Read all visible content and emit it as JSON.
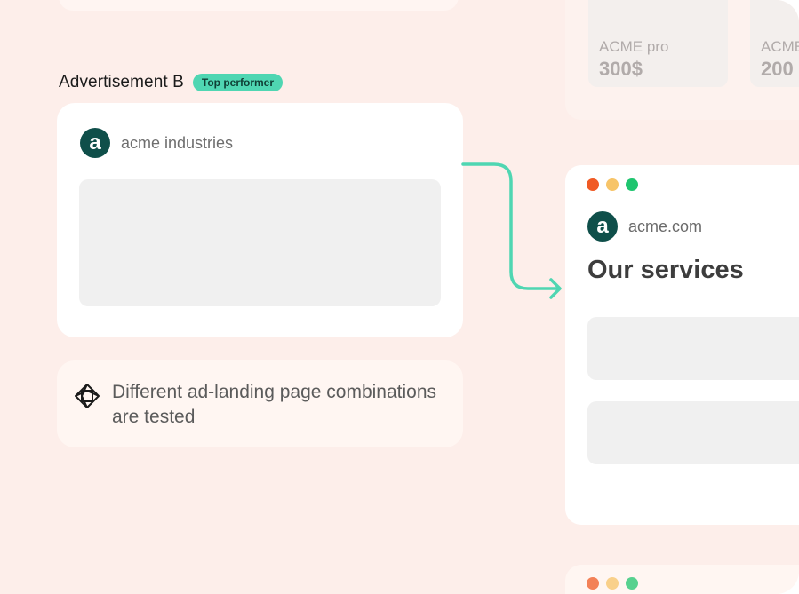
{
  "advertisement": {
    "title": "Advertisement B",
    "badge": "Top performer",
    "brand_initial": "a",
    "brand_name": "acme industries"
  },
  "info": {
    "text": "Different ad-landing page combinations are tested",
    "icon": "diamond-knot-icon"
  },
  "landing_page": {
    "brand_initial": "a",
    "domain": "acme.com",
    "heading": "Our services"
  },
  "pricing": [
    {
      "name": "ACME pro",
      "price": "300$"
    },
    {
      "name": "ACME",
      "price": "200"
    }
  ],
  "colors": {
    "background": "#fdeeea",
    "badge": "#4fd6b2",
    "connector": "#4fd6b2",
    "brand": "#0f4f4a",
    "dot_red": "#f05a24",
    "dot_yellow": "#f7c468",
    "dot_green": "#1fc56f"
  }
}
